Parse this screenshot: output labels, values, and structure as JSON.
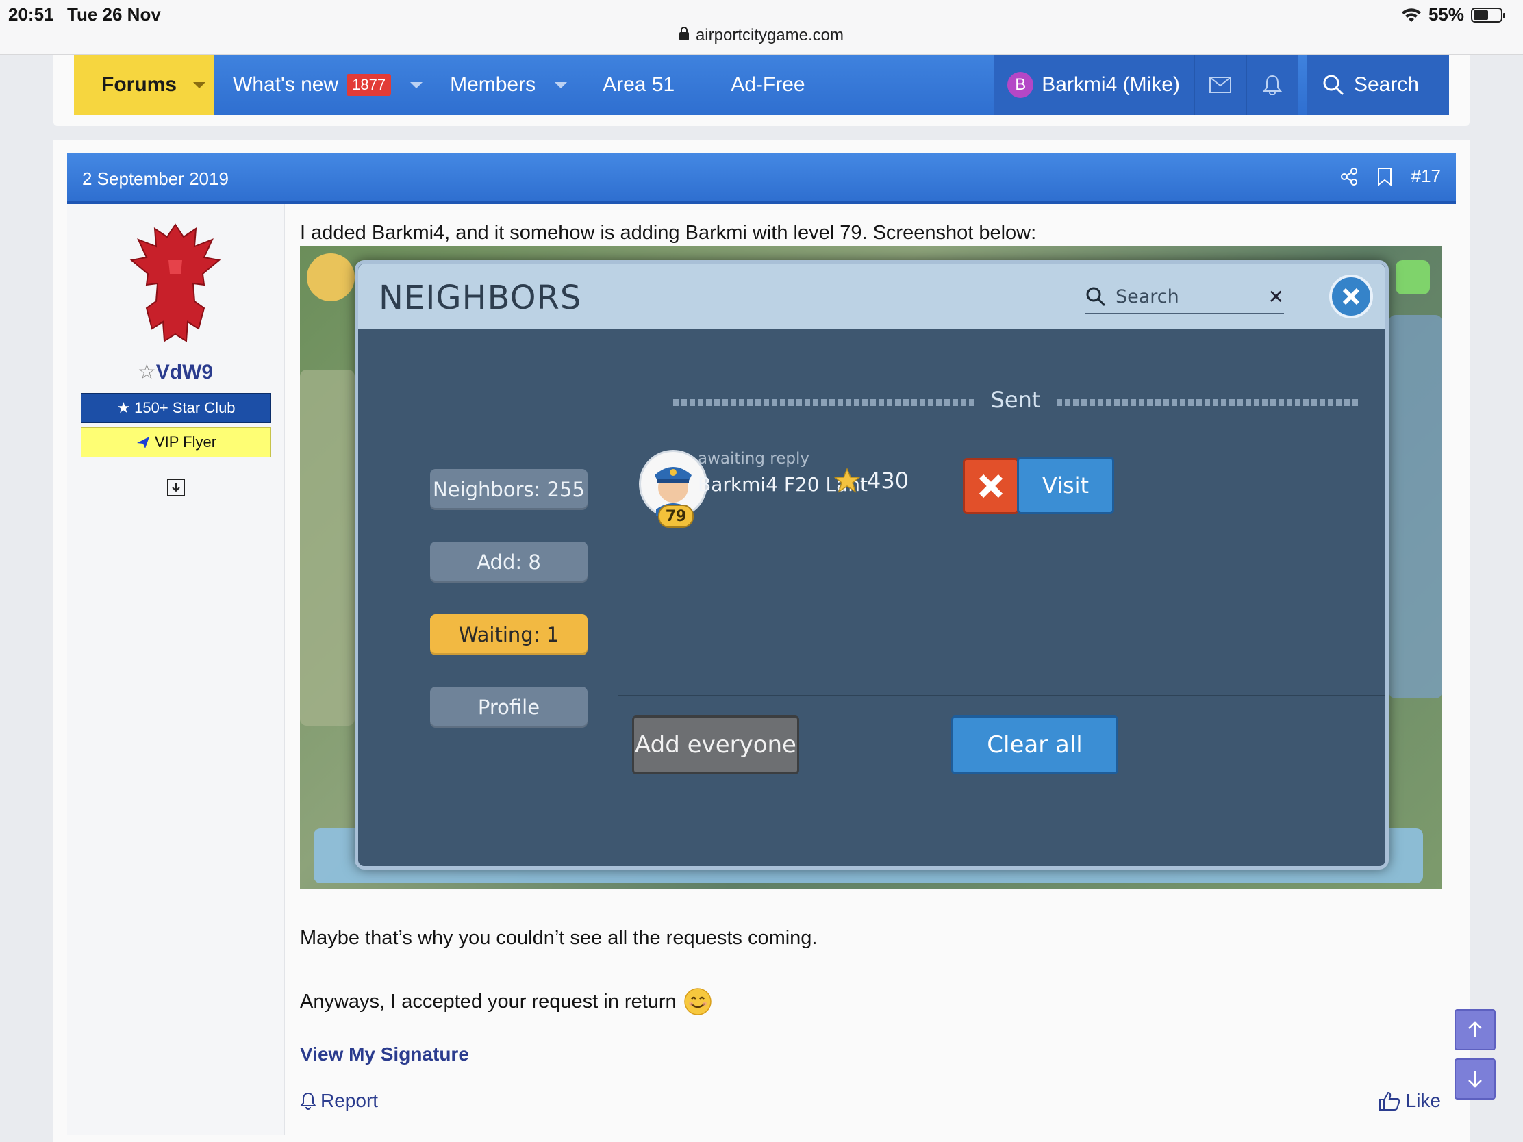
{
  "status_bar": {
    "time": "20:51",
    "date": "Tue 26 Nov",
    "battery": "55%",
    "battery_level": 0.55,
    "url": "airportcitygame.com"
  },
  "nav": {
    "forums": "Forums",
    "whats_new": "What's new",
    "whats_new_badge": "1877",
    "members": "Members",
    "area51": "Area 51",
    "adfree": "Ad-Free",
    "user_initial": "B",
    "user_name": "Barkmi4 (Mike)",
    "search": "Search"
  },
  "post": {
    "date": "2 September 2019",
    "number": "#17",
    "author": {
      "name": "VdW9",
      "banner_blue": "150+ Star Club",
      "banner_yellow": "VIP Flyer"
    },
    "text_intro": "I added Barkmi4, and it somehow is adding Barkmi with level 79. Screenshot below:",
    "text_para1": "Maybe that’s why you couldn’t see all the requests coming.",
    "text_para2": "Anyways, I accepted your request in return",
    "signature_link": "View My Signature",
    "report": "Report",
    "like": "Like"
  },
  "game": {
    "title": "NEIGHBORS",
    "search_placeholder": "Search",
    "section_label": "Sent",
    "tabs": [
      {
        "label": "Neighbors: 255",
        "active": false
      },
      {
        "label": "Add: 8",
        "active": false
      },
      {
        "label": "Waiting: 1",
        "active": true
      },
      {
        "label": "Profile",
        "active": false
      }
    ],
    "neighbor": {
      "status": "awaiting reply",
      "name": "Barkmi4 F20 Lant",
      "level": "79",
      "stars": "430",
      "visit_label": "Visit"
    },
    "add_everyone": "Add everyone",
    "clear_all": "Clear all"
  },
  "colors": {
    "nav_blue": "#3f82de",
    "forums_yellow": "#f6d63f",
    "link_blue": "#2b3c8e",
    "badge_red": "#e23b36"
  }
}
